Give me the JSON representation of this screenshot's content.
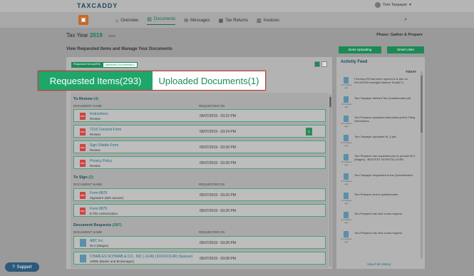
{
  "app": {
    "logo": "TAXCADDY",
    "user": "Tom Taxpayer"
  },
  "nav": {
    "items": [
      {
        "label": "Overview",
        "icon": "home-icon",
        "glyph": "⌂"
      },
      {
        "label": "Documents",
        "icon": "documents-icon",
        "glyph": "▤"
      },
      {
        "label": "Messages",
        "icon": "messages-icon",
        "glyph": "✉"
      },
      {
        "label": "Tax Returns",
        "icon": "tax-returns-icon",
        "glyph": "▦"
      },
      {
        "label": "Invoices",
        "icon": "invoices-icon",
        "glyph": "▥"
      }
    ],
    "active": "Documents"
  },
  "header": {
    "tax_year_label": "Tax Year",
    "tax_year": "2019",
    "year_small": "2020",
    "phase": "Phase: Gather & Prepare",
    "subtitle": "View Requested Items and Manage Your Documents",
    "done_uploading": "Done Uploading",
    "smart_links": "Smart Links"
  },
  "tabs": {
    "requested": "Requested Items(293)",
    "uploaded": "Uploaded Documents(1)"
  },
  "sections": {
    "review": {
      "title": "To Review",
      "count": "(4)",
      "col_name": "DOCUMENT NAME",
      "col_date": "REQUESTED ON",
      "rows": [
        {
          "name": "Instructions",
          "sub": "Review",
          "date": "05/07/2019 - 03:22 PM"
        },
        {
          "name": "7216 Consent Form",
          "sub": "Review",
          "date": "05/07/2019 - 03:24 PM"
        },
        {
          "name": "Sign Fillable Form",
          "sub": "Review",
          "date": "05/07/2019 - 03:30 PM"
        },
        {
          "name": "Privacy Policy",
          "sub": "Review",
          "date": "05/07/2019 - 03:30 PM"
        }
      ]
    },
    "sign": {
      "title": "To Sign",
      "count": "(2)",
      "col_name": "DOCUMENT NAME",
      "col_date": "REQUESTED ON",
      "rows": [
        {
          "name": "Form 8878",
          "sub": "Signature (with spouse)",
          "date": "05/07/2019 - 03:26 PM"
        },
        {
          "name": "Form 8879",
          "sub": "E-File Authorization",
          "date": "05/07/2019 - 03:26 PM"
        }
      ]
    },
    "requests": {
      "title": "Document Requests",
      "count": "(287)",
      "col_name": "DOCUMENT NAME",
      "col_date": "REQUESTED ON",
      "rows": [
        {
          "name": "ABC Inc.",
          "sub": "W-2 (Wages)",
          "date": "05/07/2019 - 03:26 PM"
        },
        {
          "name": "CHARLES SCHWAB & CO., INC (-1149) (XXXXX1149) (Spouse)",
          "sub": "1099s (Banks and Brokerages)",
          "date": "05/07/2019 - 03:08 PM"
        }
      ]
    }
  },
  "activity": {
    "title": "Activity Feed",
    "today": "TODAY",
    "items": [
      {
        "time": "10 minutes ago",
        "text": "Fed-tsup E5 has been opened & is due on 04/14/2020 midnight Eastern Time(ET)."
      },
      {
        "time": "19 minutes ago",
        "text": "Tom Taxpayer deleted Tax Questionnaire.pdf"
      },
      {
        "time": "19 minutes ago",
        "text": "Tom Preparer uploaded instructions.pdf to Filing Instructions."
      },
      {
        "time": "20 minutes ago",
        "text": "Tom Taxpayer uploaded W_2.pdf."
      },
      {
        "time": "20 minutes ago",
        "text": "Tom Preparer has requested you to provide W-2 (Wages) - BESTEST HOSPITAL EVER."
      },
      {
        "time": "20 minutes ago",
        "text": "Tom Taxpayer responded to the Questionnaire."
      },
      {
        "time": "21 minutes ago",
        "text": "Tom Preparer sent a questionnaire."
      },
      {
        "time": "21 minutes ago",
        "text": "Tom Preparer has sent a new request."
      },
      {
        "time": "21 minutes ago",
        "text": "Tom Preparer has sent a new request."
      }
    ],
    "view_history": "View Full History"
  },
  "support": {
    "label": "Support"
  }
}
